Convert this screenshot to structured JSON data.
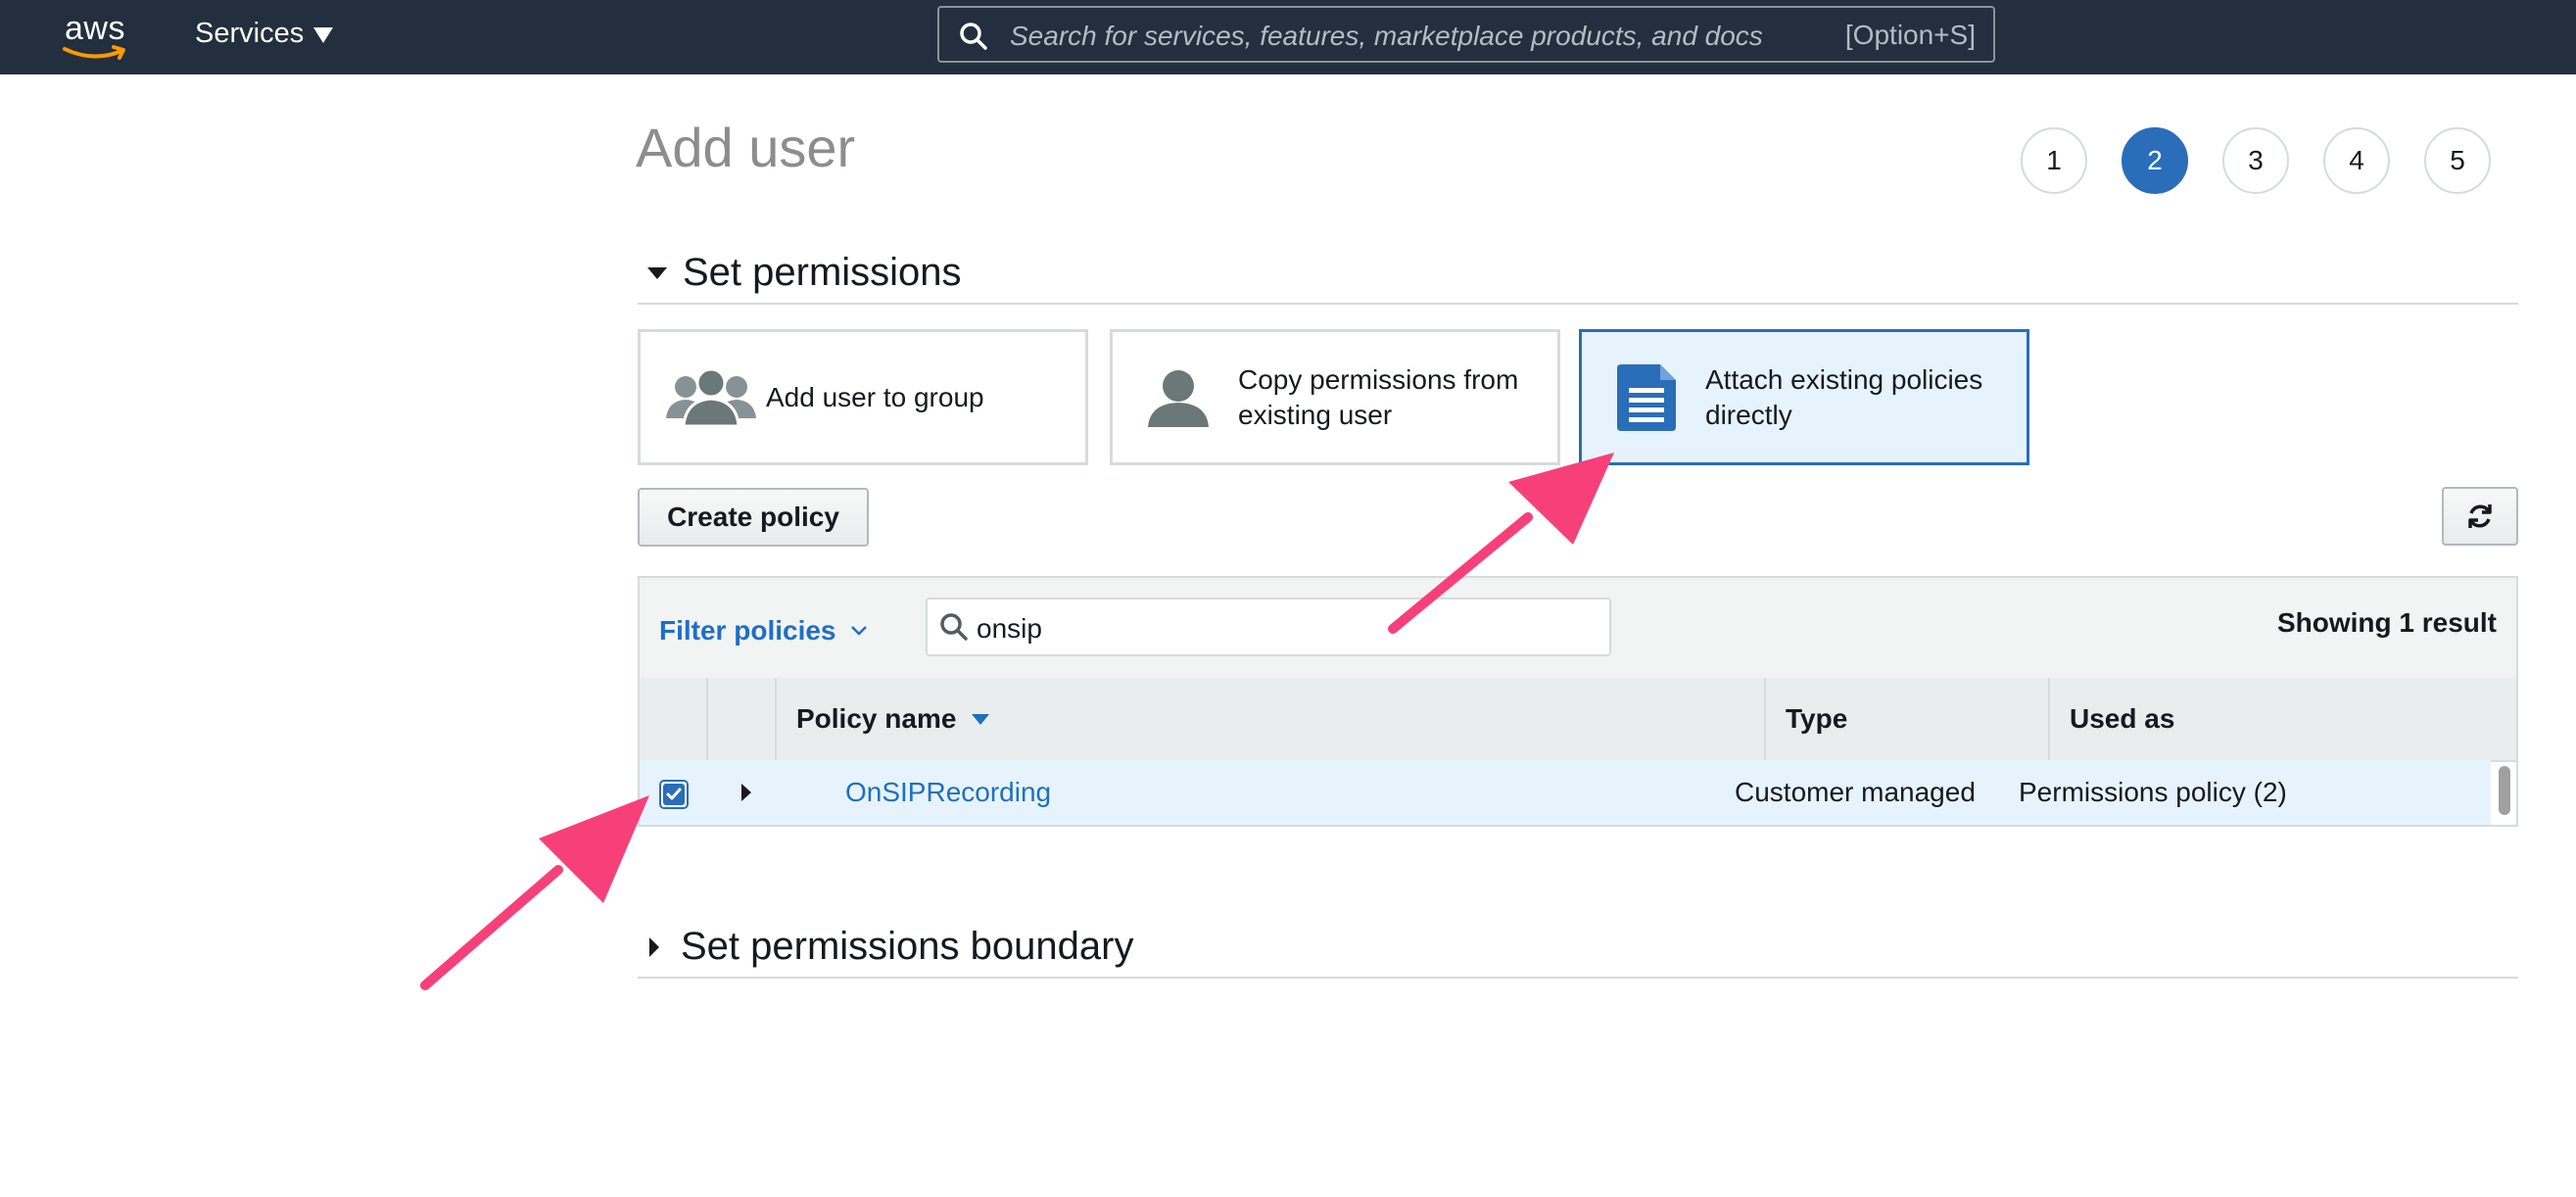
{
  "nav": {
    "logo_text": "aws",
    "services_label": "Services",
    "search_placeholder": "Search for services, features, marketplace products, and docs",
    "search_shortcut": "[Option+S]"
  },
  "page": {
    "title": "Add user",
    "steps": [
      "1",
      "2",
      "3",
      "4",
      "5"
    ],
    "active_step": "2"
  },
  "permissions": {
    "section_title": "Set permissions",
    "options": [
      {
        "label": "Add user to group",
        "icon": "group-icon",
        "selected": false
      },
      {
        "label": "Copy permissions from existing user",
        "icon": "user-icon",
        "selected": false
      },
      {
        "label": "Attach existing policies directly",
        "icon": "document-icon",
        "selected": true
      }
    ],
    "create_policy_label": "Create policy",
    "refresh_icon": "refresh-icon"
  },
  "policy_table": {
    "filter_label": "Filter policies",
    "search_value": "onsip",
    "result_count": "Showing 1 result",
    "columns": [
      "Policy name",
      "Type",
      "Used as"
    ],
    "rows": [
      {
        "checked": true,
        "name": "OnSIPRecording",
        "type": "Customer managed",
        "used_as": "Permissions policy (2)"
      }
    ]
  },
  "boundary": {
    "section_title": "Set permissions boundary"
  },
  "colors": {
    "nav_bg": "#232f3e",
    "accent": "#2a6db8",
    "link": "#1f6fc2",
    "selected_bg": "#e7f3fc",
    "annotation_arrow": "#f7407a"
  }
}
